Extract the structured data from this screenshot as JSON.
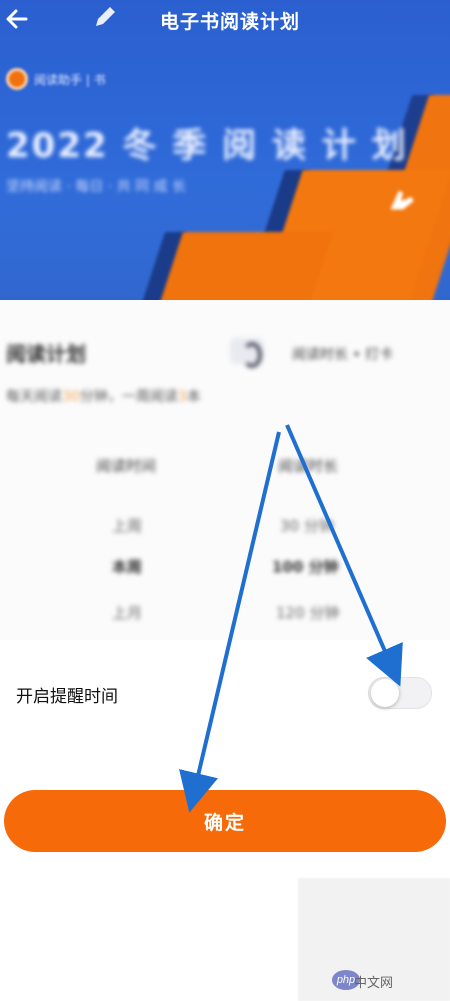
{
  "nav": {
    "back_icon": "arrow-left-icon",
    "title": "电子书阅读计划"
  },
  "banner": {
    "brand_text": "阅读助手 | 书",
    "heading": "2022 冬 季 阅 读 计 划",
    "subheading": "坚持阅读 · 每日 · 共 同 成 长",
    "colors": {
      "blue": "#2f6ad8",
      "orange": "#f3780f"
    }
  },
  "plan": {
    "name": "阅读计划",
    "tag": "阅读时长 • 打卡",
    "desc_prefix": "每天阅读",
    "desc_hl1": "30",
    "desc_mid": "分钟，一周阅读",
    "desc_hl2": "3",
    "desc_suffix": "本",
    "columns": [
      "阅读时间",
      "阅读时长"
    ],
    "rows": [
      [
        "上周",
        "30 分钟"
      ],
      [
        "本周",
        "100 分钟"
      ],
      [
        "上月",
        "120 分钟"
      ]
    ]
  },
  "reminder": {
    "label": "开启提醒时间",
    "enabled": false
  },
  "confirm_button": {
    "label": "确定",
    "color": "#f66a0a"
  },
  "watermark": {
    "logo": "php",
    "text": "中文网"
  }
}
